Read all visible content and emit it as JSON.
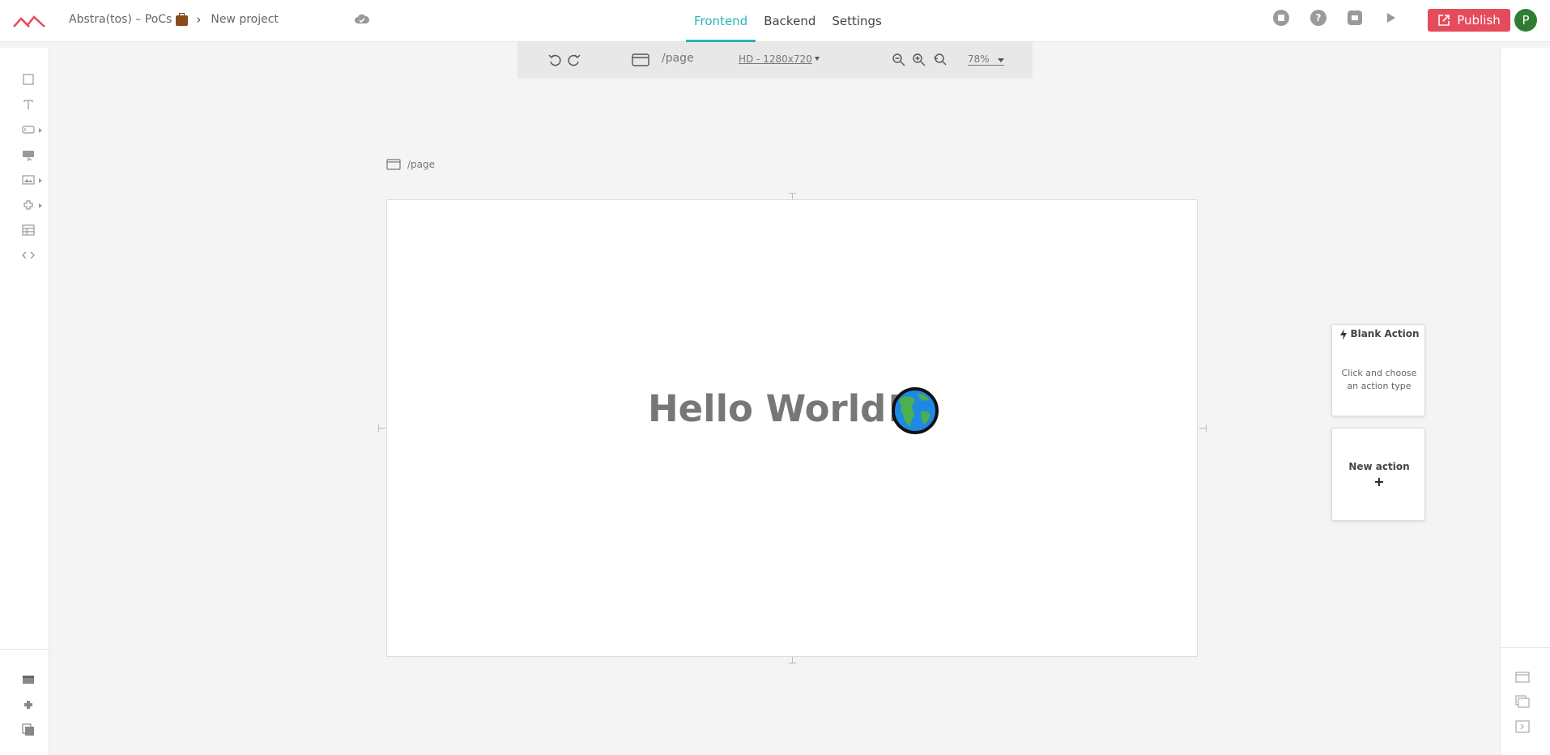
{
  "header": {
    "breadcrumb": {
      "workspace": "Abstra(tos) – PoCs",
      "project": "New project"
    },
    "tabs": [
      {
        "label": "Frontend",
        "active": true
      },
      {
        "label": "Backend",
        "active": false
      },
      {
        "label": "Settings",
        "active": false
      }
    ],
    "publish_label": "Publish",
    "avatar_initial": "P",
    "accent_color": "#2ab4bb",
    "publish_color": "#e64b5b"
  },
  "canvas_toolbar": {
    "path": "/page",
    "resolution": "HD - 1280x720",
    "zoom": "78%"
  },
  "page": {
    "label": "/page",
    "heading": "Hello World!",
    "emoji": "globe-americas"
  },
  "actions": {
    "blank": {
      "title": "Blank Action",
      "description": "Click and choose an action type"
    },
    "new": {
      "label": "New action",
      "plus": "+"
    }
  }
}
